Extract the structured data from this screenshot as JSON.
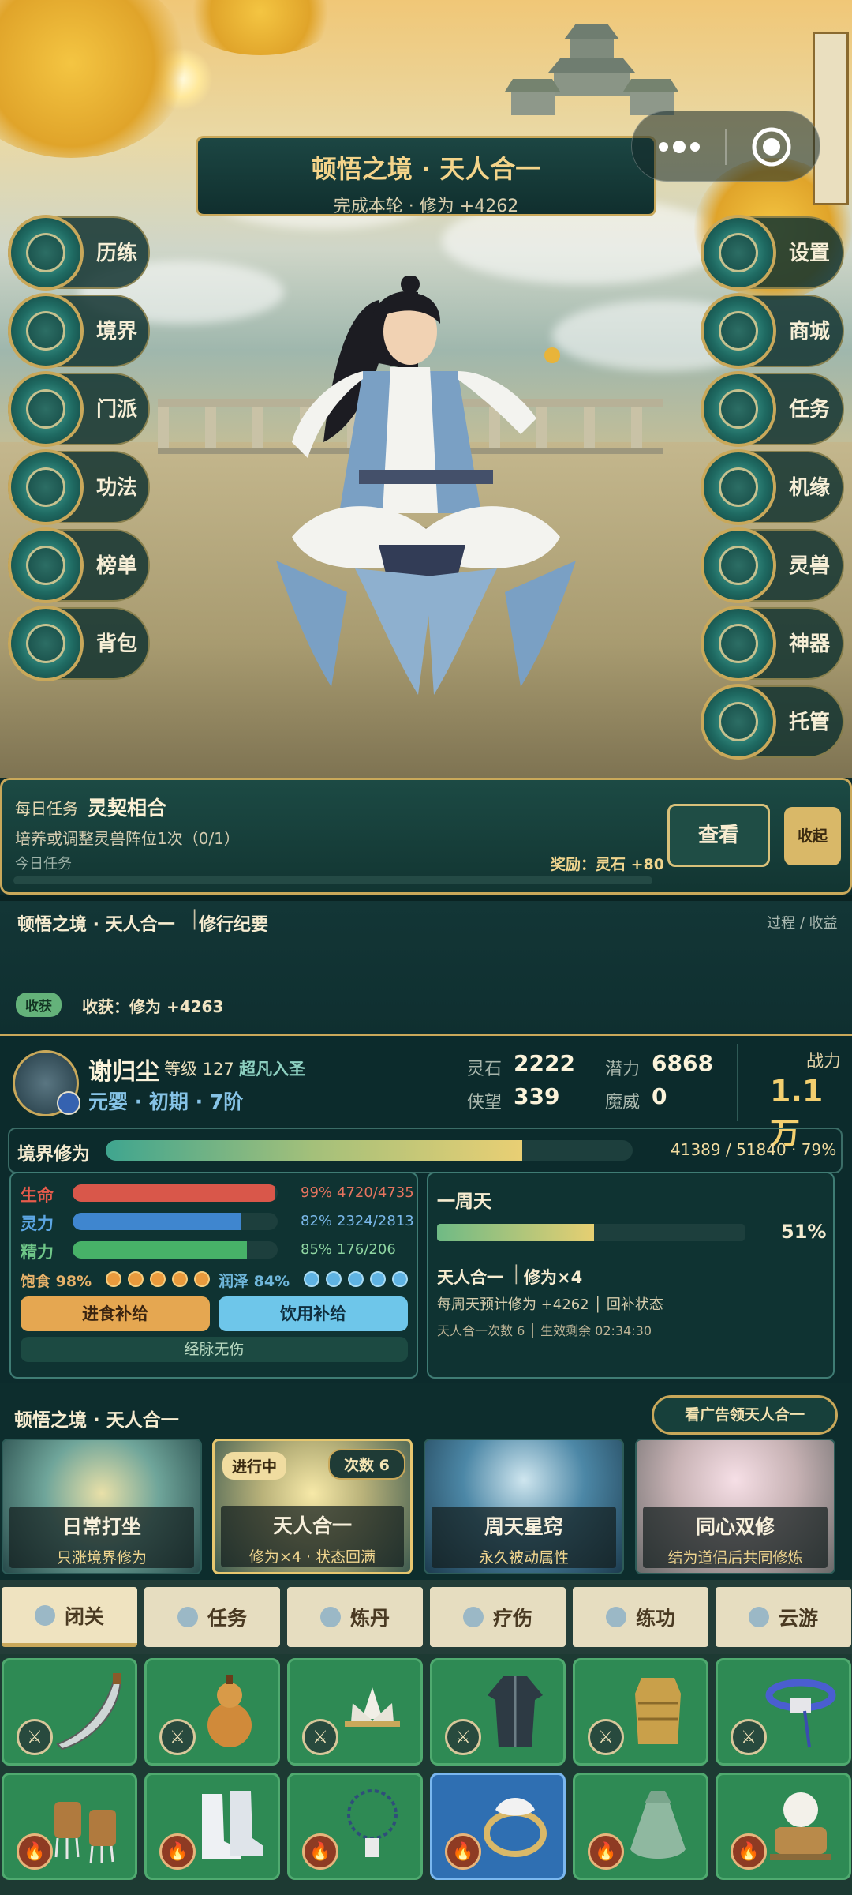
{
  "banner": {
    "title": "顿悟之境 · 天人合一",
    "subtitle": "完成本轮 · 修为 +4262"
  },
  "capsule": {
    "menu_icon": "more-dots-icon",
    "close_icon": "target-icon"
  },
  "left_menu": [
    {
      "label": "历练",
      "icon": "pagoda-icon"
    },
    {
      "label": "境界",
      "icon": "meditation-icon"
    },
    {
      "label": "门派",
      "icon": "sect-icon"
    },
    {
      "label": "功法",
      "icon": "scroll-book-icon"
    },
    {
      "label": "榜单",
      "icon": "ranking-icon"
    },
    {
      "label": "背包",
      "icon": "bag-icon"
    }
  ],
  "right_menu": [
    {
      "label": "设置",
      "icon": "gear-icon"
    },
    {
      "label": "商城",
      "icon": "shop-icon"
    },
    {
      "label": "任务",
      "icon": "task-scroll-icon"
    },
    {
      "label": "机缘",
      "icon": "fortune-icon"
    },
    {
      "label": "灵兽",
      "icon": "beast-icon"
    },
    {
      "label": "神器",
      "icon": "artifact-icon"
    },
    {
      "label": "托管",
      "icon": "auto-icon"
    }
  ],
  "daily_task": {
    "tag": "每日任务",
    "name": "灵契相合",
    "desc": "培养或调整灵兽阵位1次（0/1）",
    "sub": "今日任务",
    "reward": "奖励：灵石 +80",
    "view_btn": "查看",
    "collapse_btn": "收起"
  },
  "log": {
    "title_a": "顿悟之境 · 天人合一",
    "title_b": "修行纪要",
    "right": "过程 / 收益",
    "badge": "收获",
    "gain": "收获：修为 +4263"
  },
  "player": {
    "name": "谢归尘",
    "level": "等级 127",
    "title": "超凡入圣",
    "realm": "元婴 · 初期 · 7阶",
    "stats": [
      {
        "label": "灵石",
        "value": "2222"
      },
      {
        "label": "潜力",
        "value": "6868"
      },
      {
        "label": "侠望",
        "value": "339"
      },
      {
        "label": "魔威",
        "value": "0"
      }
    ],
    "power_label": "战力",
    "power_value": "1.1万",
    "cultivation_label": "境界修为",
    "cultivation_text": "41389 / 51840 · 79%",
    "cultivation_pct": 0.79
  },
  "vitals": [
    {
      "label": "生命",
      "pct": "99%",
      "val": "4720/4735",
      "ratio": 0.99,
      "color": "#d9574a"
    },
    {
      "label": "灵力",
      "pct": "82%",
      "val": "2324/2813",
      "ratio": 0.82,
      "color": "#3f86cf"
    },
    {
      "label": "精力",
      "pct": "85%",
      "val": "176/206",
      "ratio": 0.85,
      "color": "#47b168"
    }
  ],
  "satiety": {
    "label": "饱食 98%",
    "dots": 5
  },
  "moisture": {
    "label": "润泽 84%",
    "dots": 5
  },
  "buttons": {
    "eat": "进食补给",
    "drink": "饮用补给",
    "meridian": "经脉无伤"
  },
  "cycle": {
    "title": "一周天",
    "pct": "51%",
    "ratio": 0.51,
    "mode_a": "天人合一",
    "mode_b": "修为×4",
    "line1": "每周天预计修为 +4262 │ 回补状态",
    "line2": "天人合一次数 6 │ 生效剩余 02:34:30"
  },
  "realm": {
    "title": "顿悟之境 · 天人合一",
    "ad_btn": "看广告领天人合一",
    "cards": [
      {
        "name": "日常打坐",
        "desc": "只涨境界修为"
      },
      {
        "name": "天人合一",
        "desc": "修为×4 · 状态回满",
        "tag": "进行中",
        "count": "次数 6"
      },
      {
        "name": "周天星窍",
        "desc": "永久被动属性"
      },
      {
        "name": "同心双修",
        "desc": "结为道侣后共同修炼"
      }
    ]
  },
  "tabs": [
    {
      "label": "闭关",
      "icon": "meditate-icon"
    },
    {
      "label": "任务",
      "icon": "sword-icon"
    },
    {
      "label": "炼丹",
      "icon": "cauldron-icon"
    },
    {
      "label": "疗伤",
      "icon": "herb-icon"
    },
    {
      "label": "练功",
      "icon": "training-icon"
    },
    {
      "label": "云游",
      "icon": "cloud-icon"
    }
  ],
  "bag": [
    {
      "item": "saber-icon",
      "type": "sword-gem-icon"
    },
    {
      "item": "gourd-icon",
      "type": "sword-gem-icon"
    },
    {
      "item": "lotus-crown-icon",
      "type": "sword-gem-icon"
    },
    {
      "item": "robe-icon",
      "type": "sword-gem-icon"
    },
    {
      "item": "armor-vest-icon",
      "type": "sword-gem-icon"
    },
    {
      "item": "belt-icon",
      "type": "sword-gem-icon"
    },
    {
      "item": "claw-gauntlet-icon",
      "type": "fire-gem-icon"
    },
    {
      "item": "boots-icon",
      "type": "fire-gem-icon"
    },
    {
      "item": "bead-necklace-icon",
      "type": "fire-gem-icon"
    },
    {
      "item": "jade-ring-icon",
      "type": "fire-gem-icon"
    },
    {
      "item": "pouch-icon",
      "type": "fire-gem-icon"
    },
    {
      "item": "incense-burner-icon",
      "type": "fire-gem-icon"
    }
  ]
}
